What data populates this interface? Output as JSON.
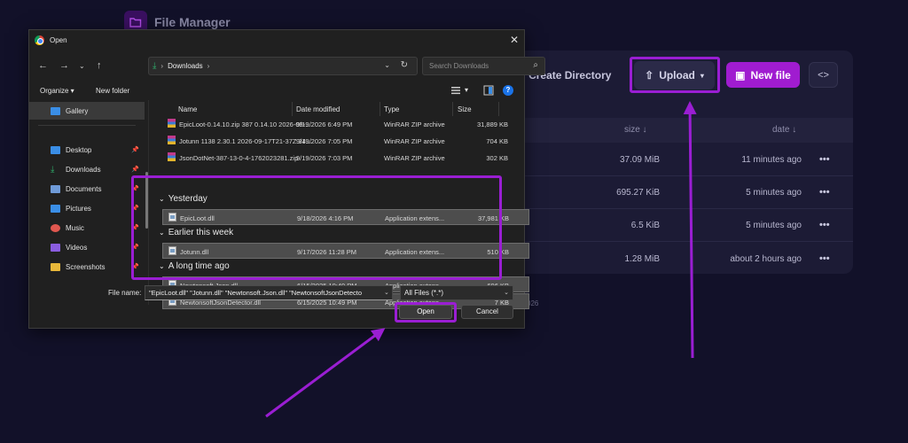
{
  "app": {
    "title": "File Manager"
  },
  "toolbar": {
    "create_directory": "Create Directory",
    "upload": "Upload",
    "new_file": "New file",
    "code_label": "<>"
  },
  "table": {
    "col_size": "size ↓",
    "col_date": "date ↓",
    "rows": [
      {
        "size": "37.09 MiB",
        "date": "11 minutes ago"
      },
      {
        "size": "695.27 KiB",
        "date": "5 minutes ago"
      },
      {
        "size": "6.5 KiB",
        "date": "5 minutes ago"
      },
      {
        "size": "1.28 MiB",
        "date": "about 2 hours ago"
      }
    ],
    "row_menu": "•••"
  },
  "footer_fragment": "026",
  "dialog": {
    "title": "Open",
    "close": "✕",
    "address": "Downloads",
    "search_placeholder": "Search Downloads",
    "organize": "Organize ▾",
    "new_folder": "New folder",
    "sidebar": [
      {
        "label": "Gallery",
        "icon": "gallery-icon",
        "color": "#3a8ee6"
      },
      {
        "label": "Desktop",
        "icon": "desktop-icon",
        "color": "#3a8ee6"
      },
      {
        "label": "Downloads",
        "icon": "downloads-icon",
        "color": "#2fb36e"
      },
      {
        "label": "Documents",
        "icon": "documents-icon",
        "color": "#6f9bd8"
      },
      {
        "label": "Pictures",
        "icon": "pictures-icon",
        "color": "#3a8ee6"
      },
      {
        "label": "Music",
        "icon": "music-icon",
        "color": "#e0574f"
      },
      {
        "label": "Videos",
        "icon": "videos-icon",
        "color": "#8a5de0"
      },
      {
        "label": "Screenshots",
        "icon": "folder-icon",
        "color": "#e8b83a"
      }
    ],
    "columns": {
      "name": "Name",
      "modified": "Date modified",
      "type": "Type",
      "size": "Size"
    },
    "files_top": [
      {
        "name": "EpicLoot-0.14.10.zip 387 0.14.10 2026-09-...",
        "modified": "9/19/2026 6:49 PM",
        "type": "WinRAR ZIP archive",
        "size": "31,889 KB"
      },
      {
        "name": "Jotunn 1138 2.30.1 2026-09-17T21-37Z 34...",
        "modified": "9/19/2026 7:05 PM",
        "type": "WinRAR ZIP archive",
        "size": "704 KB"
      },
      {
        "name": "JsonDotNet-387-13-0-4-1762023281.zip",
        "modified": "9/19/2026 7:03 PM",
        "type": "WinRAR ZIP archive",
        "size": "302 KB"
      }
    ],
    "groups": {
      "yesterday": "Yesterday",
      "earlier": "Earlier this week",
      "longago": "A long time ago"
    },
    "files_yesterday": [
      {
        "name": "EpicLoot.dll",
        "modified": "9/18/2026 4:16 PM",
        "type": "Application extens...",
        "size": "37,981 KB"
      }
    ],
    "files_earlier": [
      {
        "name": "Jotunn.dll",
        "modified": "9/17/2026 11:28 PM",
        "type": "Application extens...",
        "size": "510 KB"
      }
    ],
    "files_longago": [
      {
        "name": "Newtonsoft.Json.dll",
        "modified": "6/15/2025 10:49 PM",
        "type": "Application extens...",
        "size": "696 KB"
      },
      {
        "name": "NewtonsoftJsonDetector.dll",
        "modified": "6/15/2025 10:49 PM",
        "type": "Application extens...",
        "size": "7 KB"
      }
    ],
    "file_name_label": "File name:",
    "file_name_value": "\"EpicLoot.dll\" \"Jotunn.dll\" \"Newtonsoft.Json.dll\" \"NewtonsoftJsonDetecto",
    "file_type_value": "All Files (*.*)",
    "open_btn": "Open",
    "cancel_btn": "Cancel"
  },
  "colors": {
    "highlight": "#9a1ed3",
    "accent": "#a01cd0"
  }
}
